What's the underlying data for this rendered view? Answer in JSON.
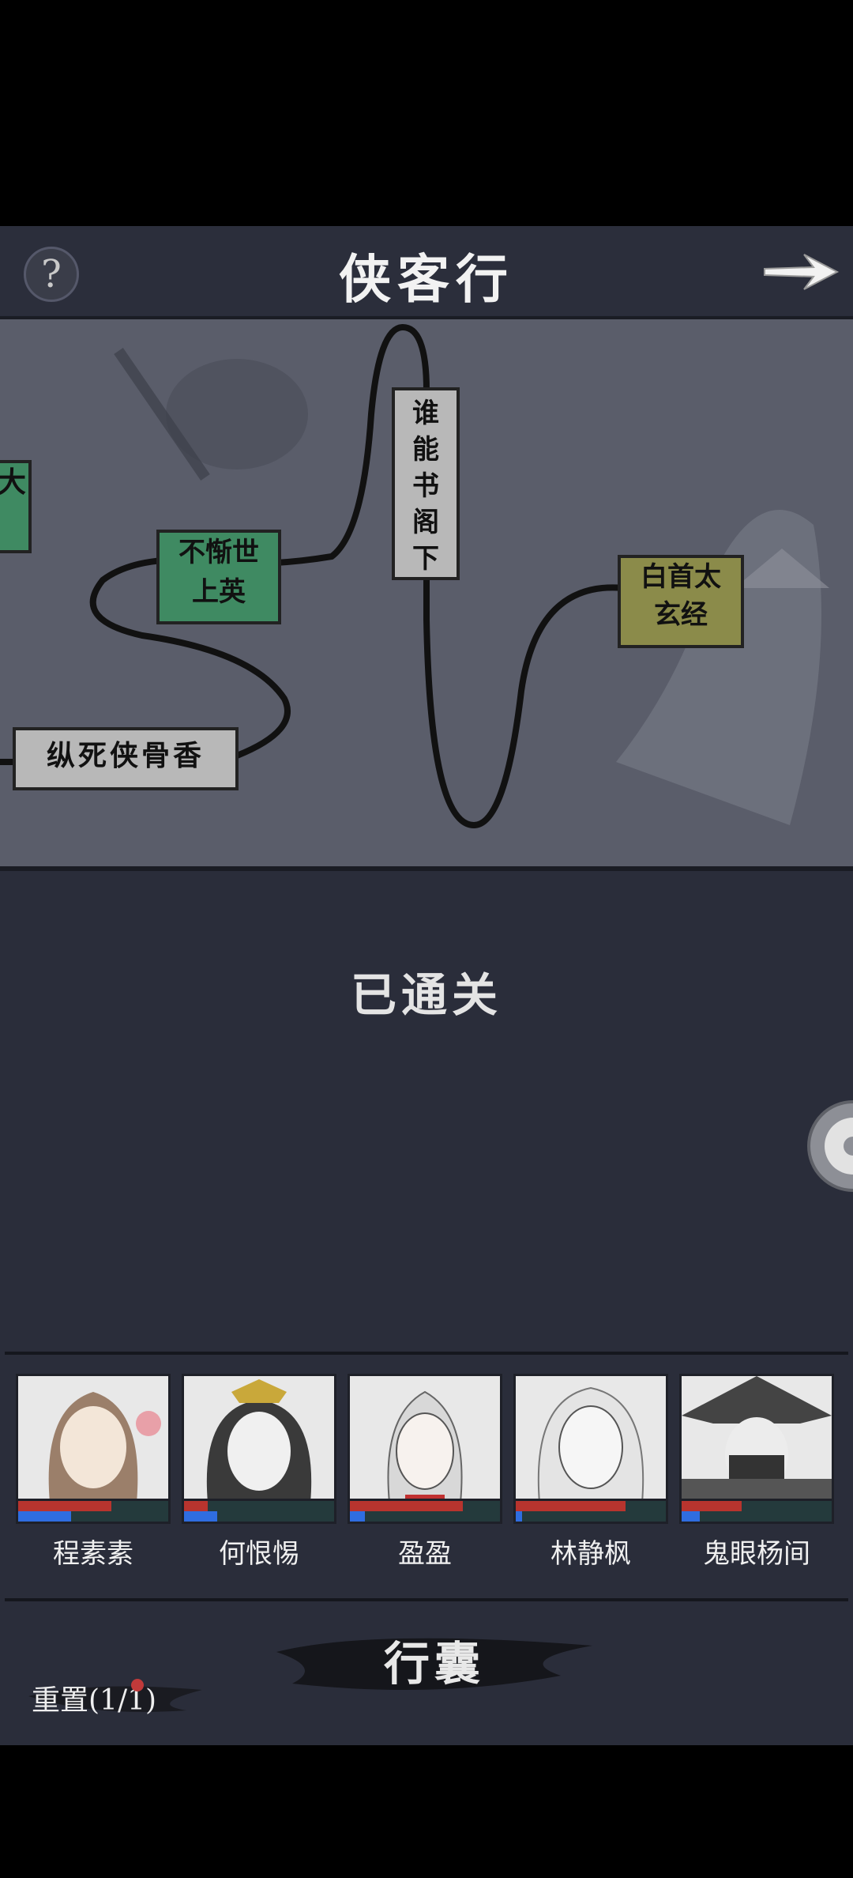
{
  "header": {
    "title": "侠客行",
    "help_label": "?"
  },
  "map": {
    "nodes": [
      {
        "id": "left-edge",
        "text": "大",
        "style": "green"
      },
      {
        "id": "buchishi",
        "line1": "不惭世",
        "line2": "上英",
        "style": "green"
      },
      {
        "id": "shuineng",
        "text": [
          "谁",
          "能",
          "书",
          "阁",
          "下"
        ],
        "style": "grey"
      },
      {
        "id": "baishou",
        "line1": "白首太",
        "line2": "玄经",
        "style": "olive"
      },
      {
        "id": "zongsi",
        "text": "纵死侠骨香",
        "style": "grey"
      }
    ]
  },
  "status": {
    "cleared": "已通关"
  },
  "party": [
    {
      "name": "程素素",
      "hp": 0.62,
      "mp": 0.35
    },
    {
      "name": "何恨惕",
      "hp": 0.16,
      "mp": 0.22
    },
    {
      "name": "盈盈",
      "hp": 0.75,
      "mp": 0.1
    },
    {
      "name": "林静枫",
      "hp": 0.73,
      "mp": 0.04
    },
    {
      "name": "鬼眼杨间",
      "hp": 0.4,
      "mp": 0.12
    }
  ],
  "bottom": {
    "bag_label": "行囊",
    "reset_label": "重置(1/1)"
  },
  "colors": {
    "hp": "#b8342e",
    "mp": "#2f6de0",
    "node_green": "#3f8a62",
    "node_olive": "#8b8b4a",
    "node_grey": "#b8b8b8"
  },
  "icons": {
    "help": "question-icon",
    "next": "arrow-right-icon",
    "settings": "gear-icon"
  }
}
